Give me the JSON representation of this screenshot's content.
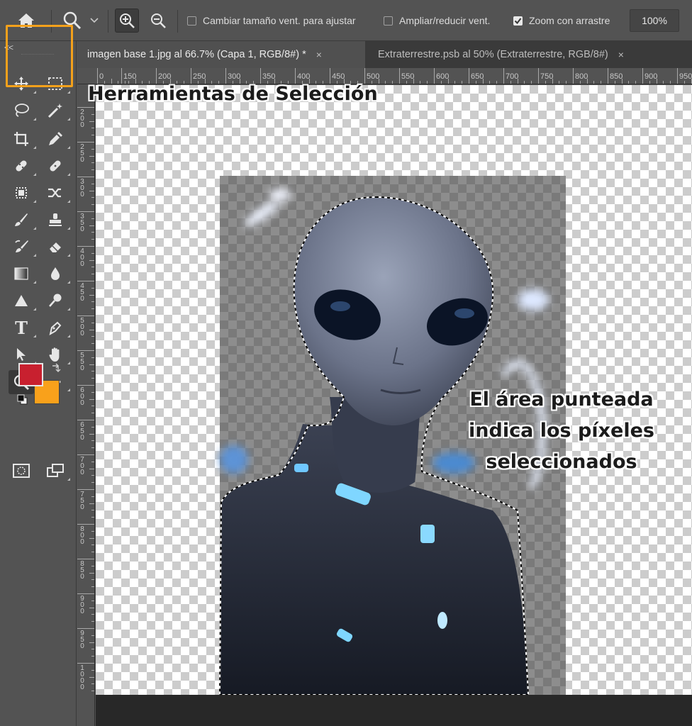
{
  "options_bar": {
    "home_icon": "home-icon",
    "zoom_tool_icon": "zoom-tool-icon",
    "zoom_in_icon": "zoom-in-icon",
    "zoom_out_icon": "zoom-out-icon",
    "resize_windows_label": "Cambiar tamaño vent. para ajustar",
    "resize_windows_checked": false,
    "zoom_all_windows_label": "Ampliar/reducir vent.",
    "zoom_all_windows_checked": false,
    "scrubby_zoom_label": "Zoom con arrastre",
    "scrubby_zoom_checked": true,
    "zoom_value": "100%"
  },
  "tabs": [
    {
      "label": "imagen base 1.jpg al 66.7% (Capa 1, RGB/8#) *",
      "active": true
    },
    {
      "label": "Extraterrestre.psb al 50% (Extraterrestre, RGB/8#)",
      "active": false
    }
  ],
  "tab_close_glyph": "×",
  "rulers": {
    "horizontal": [
      "0",
      "150",
      "200",
      "250",
      "300",
      "350",
      "400",
      "450",
      "500",
      "550",
      "600",
      "650",
      "700",
      "750",
      "800",
      "850",
      "900",
      "950"
    ],
    "vertical": [
      "200",
      "250",
      "300",
      "350",
      "400",
      "450",
      "500",
      "550",
      "600",
      "650",
      "700",
      "750",
      "800",
      "850",
      "900",
      "950",
      "1000"
    ]
  },
  "toolbar": {
    "collapse_glyph": "<<",
    "tools": [
      "move-tool",
      "marquee-tool",
      "lasso-tool",
      "magic-wand-tool",
      "crop-tool",
      "eyedropper-tool",
      "spot-healing-tool",
      "healing-brush-tool",
      "content-aware-move-tool",
      "red-eye-tool",
      "brush-tool",
      "clone-stamp-tool",
      "history-brush-tool",
      "eraser-tool",
      "gradient-tool",
      "blur-tool",
      "shape-tool",
      "dodge-tool",
      "type-tool",
      "pen-tool",
      "path-selection-tool",
      "hand-tool",
      "zoom-tool",
      "more-tools",
      "quick-mask",
      "screen-mode"
    ],
    "type_glyph": "T",
    "more_glyph": "•••",
    "foreground_color": "#c8202f",
    "background_color": "#f9a11b"
  },
  "annotations": {
    "selection_tools": "Herramientas de Selección",
    "note_line1": "El área punteada",
    "note_line2": "indica los píxeles",
    "note_line3": "seleccionados"
  },
  "colors": {
    "accent_highlight": "#f4a11b",
    "panel": "#535353",
    "tab_bar": "#3a3a3a"
  }
}
